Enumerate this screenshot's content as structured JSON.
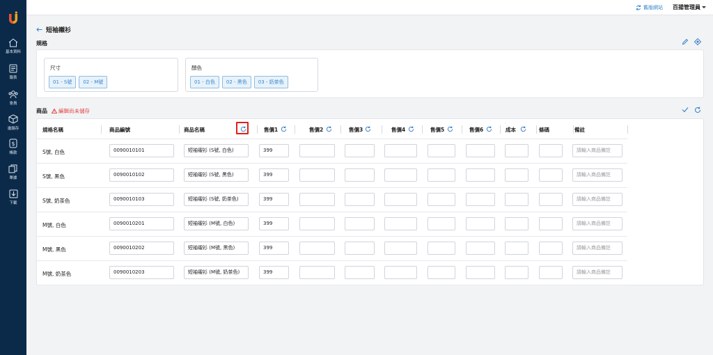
{
  "colors": {
    "sidebar": "#0b2a4a",
    "accent": "#3a85c9",
    "warning": "#e24848",
    "highlight": "#e0201b"
  },
  "nav": [
    {
      "label": "基本資料",
      "icon": "home-icon"
    },
    {
      "label": "報表",
      "icon": "report-icon"
    },
    {
      "label": "會員",
      "icon": "members-icon"
    },
    {
      "label": "進銷存",
      "icon": "box-icon"
    },
    {
      "label": "帳款",
      "icon": "dollar-icon"
    },
    {
      "label": "單據",
      "icon": "documents-icon"
    },
    {
      "label": "下載",
      "icon": "download-icon"
    }
  ],
  "topbar": {
    "old_site": "舊版網站",
    "user": "百揚管理員"
  },
  "page": {
    "title": "短袖襯衫"
  },
  "spec": {
    "heading": "規格",
    "size": {
      "label": "尺寸",
      "options": [
        "01 - S號",
        "02 - M號"
      ]
    },
    "color": {
      "label": "顏色",
      "options": [
        "01 - 白色",
        "02 - 黑色",
        "03 - 奶茶色"
      ]
    }
  },
  "products": {
    "heading": "商品",
    "warning": "編輯尚未儲存",
    "columns": [
      "規格名稱",
      "商品編號",
      "商品名稱",
      "售價1",
      "售價2",
      "售價3",
      "售價4",
      "售價5",
      "售價6",
      "成本",
      "條碼",
      "備註"
    ],
    "note_placeholder": "請輸入商品備註",
    "rows": [
      {
        "spec": "S號, 白色",
        "code": "0090010101",
        "name": "短袖襯衫 (S號, 白色)",
        "price1": "399"
      },
      {
        "spec": "S號, 黑色",
        "code": "0090010102",
        "name": "短袖襯衫 (S號, 黑色)",
        "price1": "399"
      },
      {
        "spec": "S號, 奶茶色",
        "code": "0090010103",
        "name": "短袖襯衫 (S號, 奶茶色)",
        "price1": "399"
      },
      {
        "spec": "M號, 白色",
        "code": "0090010201",
        "name": "短袖襯衫 (M號, 白色)",
        "price1": "399"
      },
      {
        "spec": "M號, 黑色",
        "code": "0090010202",
        "name": "短袖襯衫 (M號, 黑色)",
        "price1": "399"
      },
      {
        "spec": "M號, 奶茶色",
        "code": "0090010203",
        "name": "短袖襯衫 (M號, 奶茶色)",
        "price1": "399"
      }
    ]
  }
}
